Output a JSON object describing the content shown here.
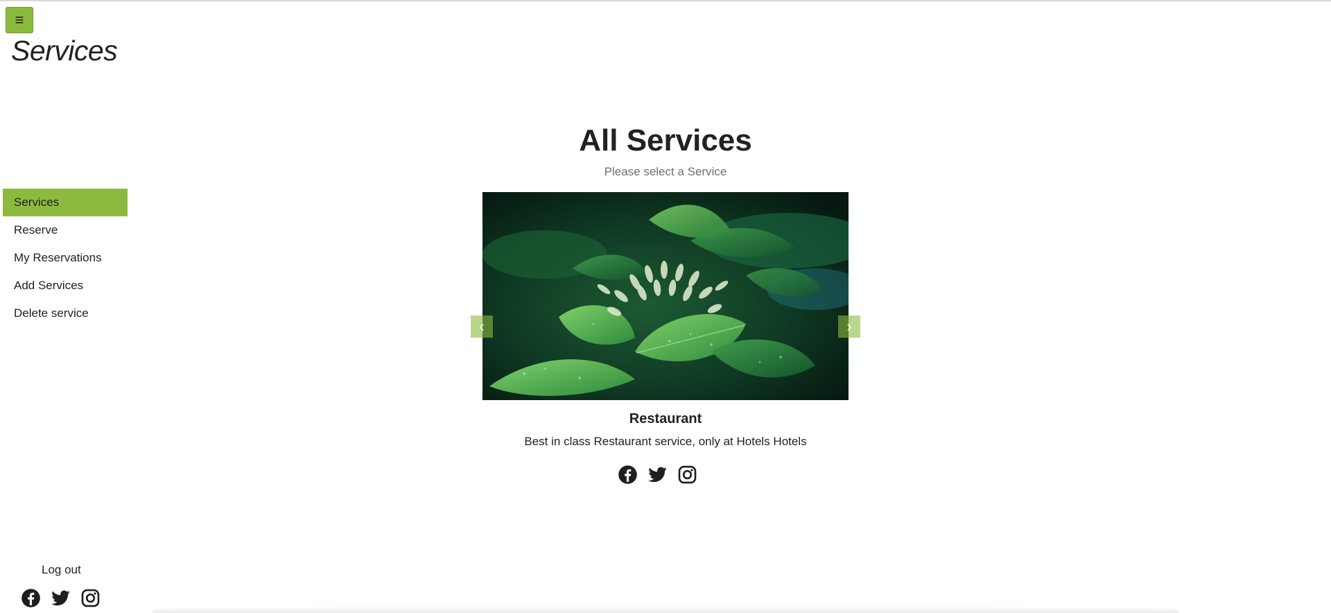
{
  "header": {
    "menu_icon": "hamburger-icon",
    "menu_glyph": "≡",
    "page_title": "Services"
  },
  "sidebar": {
    "items": [
      {
        "label": "Services",
        "active": true
      },
      {
        "label": "Reserve",
        "active": false
      },
      {
        "label": "My Reservations",
        "active": false
      },
      {
        "label": "Add Services",
        "active": false
      },
      {
        "label": "Delete service",
        "active": false
      }
    ],
    "logout_label": "Log out",
    "social_icons": [
      "facebook-icon",
      "twitter-icon",
      "instagram-icon"
    ]
  },
  "main": {
    "title": "All Services",
    "subtitle": "Please select a Service",
    "carousel": {
      "prev_glyph": "‹",
      "next_glyph": "›",
      "image": "green-plant-photo"
    },
    "service": {
      "name": "Restaurant",
      "description": "Best in class Restaurant service, only at Hotels Hotels"
    },
    "social_icons": [
      "facebook-icon",
      "twitter-icon",
      "instagram-icon"
    ]
  },
  "colors": {
    "accent": "#8cba3f",
    "text": "#1f1f1f",
    "muted": "#6f6f6f",
    "background": "#ffffff"
  }
}
